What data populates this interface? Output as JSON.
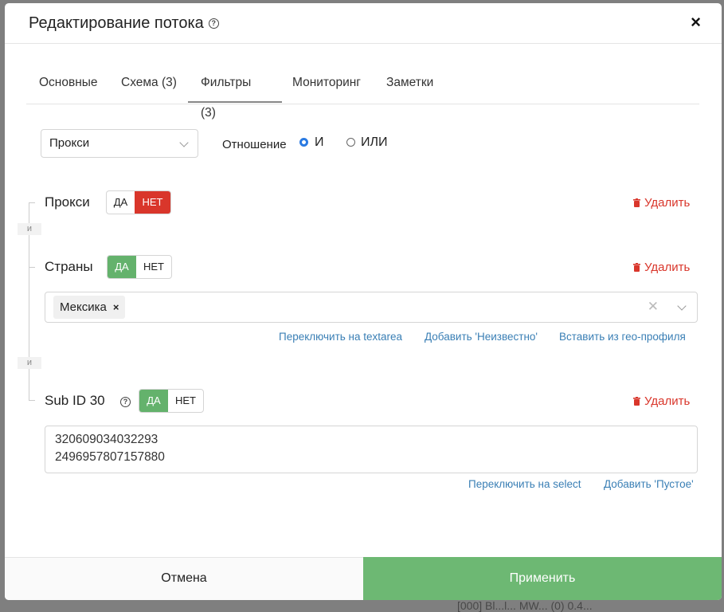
{
  "modal": {
    "title": "Редактирование потока",
    "close_label": "×",
    "tabs": [
      {
        "label": "Основные"
      },
      {
        "label": "Схема (3)"
      },
      {
        "label": "Фильтры (3)"
      },
      {
        "label": "Мониторинг"
      },
      {
        "label": "Заметки"
      }
    ],
    "active_tab": "Фильтры (3)"
  },
  "filter_select": {
    "value": "Прокси"
  },
  "relation": {
    "label": "Отношение",
    "options": [
      {
        "label": "И",
        "checked": true
      },
      {
        "label": "ИЛИ",
        "checked": false
      }
    ]
  },
  "connector_label": "и",
  "filters": [
    {
      "name": "Прокси",
      "yes": "ДА",
      "no": "НЕТ",
      "selected": "НЕТ",
      "delete": "Удалить"
    },
    {
      "name": "Страны",
      "yes": "ДА",
      "no": "НЕТ",
      "selected": "ДА",
      "delete": "Удалить",
      "tags": [
        "Мексика"
      ],
      "links": [
        "Переключить на textarea",
        "Добавить 'Неизвестно'",
        "Вставить из гео-профиля"
      ]
    },
    {
      "name": "Sub ID 30",
      "yes": "ДА",
      "no": "НЕТ",
      "selected": "ДА",
      "delete": "Удалить",
      "values": [
        "320609034032293",
        "2496957807157880"
      ],
      "links": [
        "Переключить на select",
        "Добавить 'Пустое'"
      ]
    }
  ],
  "footer": {
    "cancel": "Отмена",
    "apply": "Применить"
  },
  "background": {
    "fragment": "[000] Bl...l... MW... (0) 0.4..."
  },
  "colors": {
    "red": "#d9362b",
    "green": "#64b26c",
    "apply_bg": "#6db873",
    "link": "#3a7fb5",
    "radio": "#2a7ae2"
  }
}
